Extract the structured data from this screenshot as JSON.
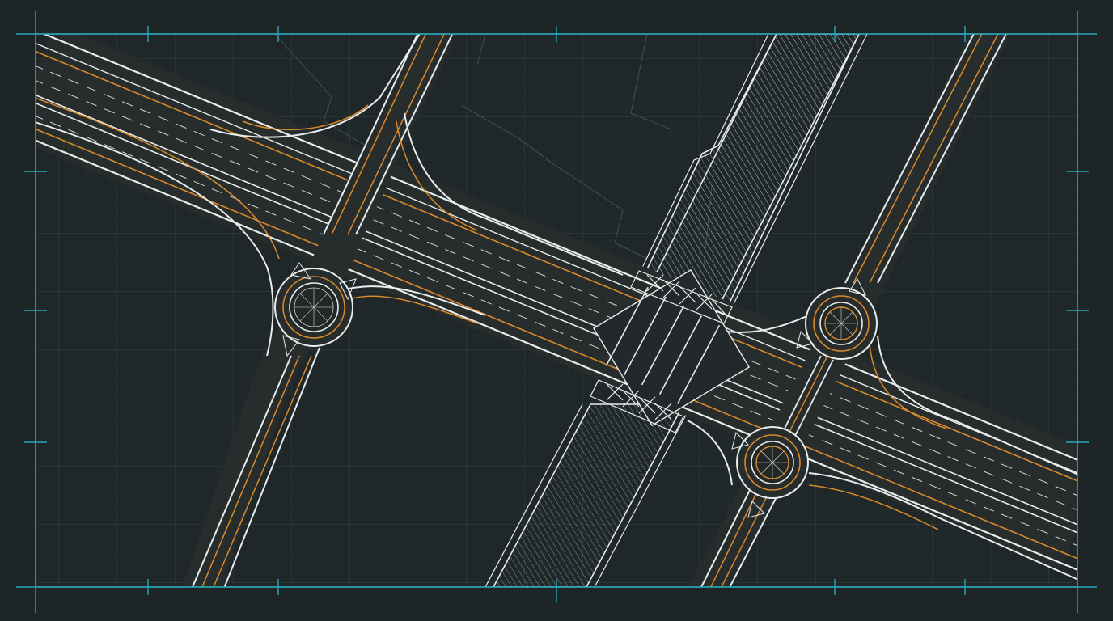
{
  "colors": {
    "background": "#1e2526",
    "frame": "#2aa7b8",
    "grid": "#35413f",
    "grid_minor": "#2a3433",
    "road_fill": "#272c2d",
    "road_edge": "#e8ecec",
    "lane_line": "#cfd6d6",
    "accent_orange": "#d98a2b",
    "terrain_line": "#4a5557",
    "hatch": "#bfc7c7"
  },
  "drawing": {
    "type": "cad-road-interchange-plan",
    "features": [
      "main-highway",
      "north-roundabout",
      "south-roundabout",
      "overpass-bridge",
      "hatched-crossing-road",
      "secondary-arterial-roads"
    ],
    "grid": true,
    "frame_with_ticks": true
  }
}
